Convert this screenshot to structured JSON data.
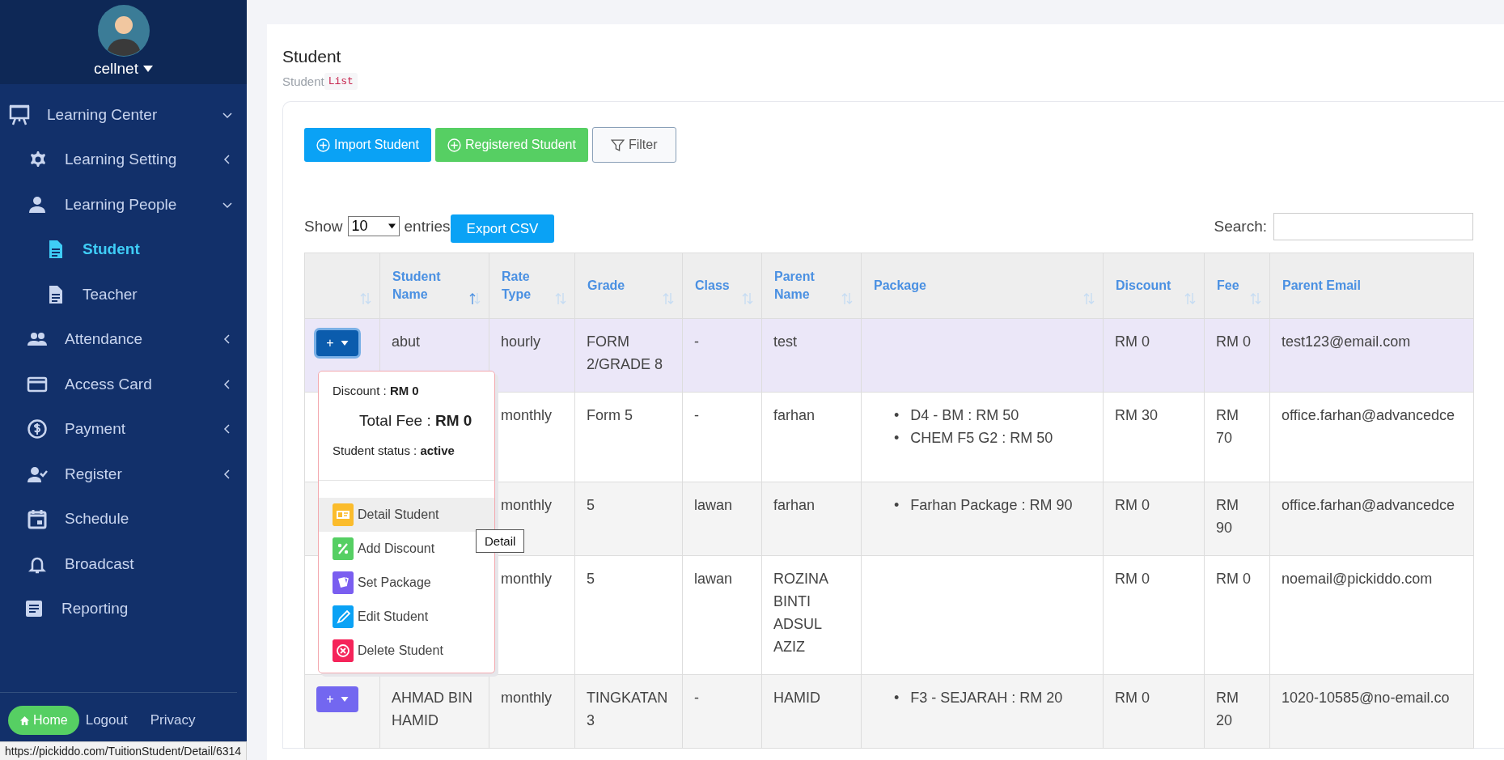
{
  "sidebar": {
    "user": {
      "name": "cellnet"
    },
    "items": [
      {
        "label": "Learning Center",
        "selected": false,
        "expanded": true,
        "children": [
          {
            "label": "Learning Setting",
            "selected": false,
            "expanded": false
          },
          {
            "label": "Learning People",
            "selected": false,
            "expanded": true,
            "children": [
              {
                "label": "Student",
                "selected": true
              },
              {
                "label": "Teacher",
                "selected": false
              }
            ]
          },
          {
            "label": "Attendance",
            "selected": false,
            "expanded": false
          },
          {
            "label": "Access Card",
            "selected": false,
            "expanded": false
          },
          {
            "label": "Payment",
            "selected": false,
            "expanded": false
          },
          {
            "label": "Register",
            "selected": false,
            "expanded": false
          },
          {
            "label": "Schedule",
            "selected": false
          },
          {
            "label": "Broadcast",
            "selected": false
          },
          {
            "label": "Reporting",
            "selected": false
          }
        ]
      }
    ],
    "footer": [
      {
        "label": "Home",
        "kind": "button"
      },
      {
        "label": "Logout",
        "kind": "link"
      },
      {
        "label": "Privacy",
        "kind": "link"
      }
    ]
  },
  "page": {
    "title": "Student",
    "breadcrumb": [
      "Student",
      "List"
    ]
  },
  "toolbar": {
    "buttons": [
      {
        "label": "Import Student",
        "kind": "primary"
      },
      {
        "label": "Registered Student",
        "kind": "success"
      },
      {
        "label": "Filter",
        "kind": "outline"
      }
    ]
  },
  "table_controls": {
    "show_label": "Show",
    "page_size": "10",
    "entries_label": "entries",
    "export_button": "Export CSV",
    "search_label": "Search:"
  },
  "table": {
    "columns": [
      {
        "sortable": true,
        "sorted": false
      },
      {
        "label": "Student Name",
        "sortable": true,
        "sorted": true
      },
      {
        "label": "Rate Type",
        "sortable": true,
        "sorted": false
      },
      {
        "label": "Grade",
        "sortable": true,
        "sorted": false
      },
      {
        "label": "Class",
        "sortable": true,
        "sorted": false
      },
      {
        "label": "Parent Name",
        "sortable": true,
        "sorted": false
      },
      {
        "label": "Package",
        "sortable": true,
        "sorted": false
      },
      {
        "label": "Discount",
        "sortable": true,
        "sorted": false
      },
      {
        "label": "Fee",
        "sortable": true,
        "sorted": false
      },
      {
        "label": "Parent Email",
        "sortable": false
      }
    ],
    "rows": [
      {
        "selected": true,
        "action": {
          "label": "+",
          "color": "#0b5cad",
          "open": true
        },
        "student_name": "abut",
        "rate_type": "hourly",
        "grade": "FORM 2/GRADE 8",
        "class": "-",
        "parent_name": "test",
        "discount": "RM 0",
        "fee": "RM 0",
        "parent_email": "test123@email.com"
      },
      {
        "selected": false,
        "rate_type": "monthly",
        "grade": "Form 5",
        "class": "-",
        "parent_name": "farhan",
        "package": [
          {
            "bullet": "•",
            "text": "D4 - BM : RM 50"
          },
          {
            "bullet": "•",
            "text": "CHEM F5 G2 : RM 50"
          }
        ],
        "discount": "RM 30",
        "fee": "RM 70",
        "parent_email": "office.farhan@advancedce"
      },
      {
        "selected": false,
        "rate_type": "monthly",
        "grade": "5",
        "class": "lawan",
        "parent_name": "farhan",
        "package": [
          {
            "bullet": "•",
            "text": "Farhan Package : RM 90"
          }
        ],
        "discount": "RM 0",
        "fee": "RM 90",
        "parent_email": "office.farhan@advancedce"
      },
      {
        "selected": false,
        "rate_type": "monthly",
        "grade": "5",
        "class": "lawan",
        "parent_name": "ROZINA BINTI ADSUL AZIZ",
        "discount": "RM 0",
        "fee": "RM 0",
        "parent_email": "noemail@pickiddo.com"
      },
      {
        "selected": false,
        "action": {
          "label": "+",
          "color": "#7367f0",
          "open": false
        },
        "student_name": "AHMAD BIN HAMID",
        "rate_type": "monthly",
        "grade": "TINGKATAN 3",
        "class": "-",
        "parent_name": "HAMID",
        "package": [
          {
            "bullet": "•",
            "text": "F3 - SEJARAH : RM 20"
          }
        ],
        "discount": "RM 0",
        "fee": "RM 20",
        "parent_email": "1020-10585@no-email.co"
      }
    ]
  },
  "action_menu": {
    "info": [
      {
        "text": "Discount : **RM 0**",
        "kind": "small"
      },
      {
        "text": "Total Fee : **RM 0**",
        "kind": "large"
      },
      {
        "text": "Student status : **active**",
        "kind": "small"
      }
    ],
    "items": [
      {
        "label": "Detail Student",
        "color": "#fbbc2c",
        "selected": true
      },
      {
        "label": "Add Discount",
        "color": "#55cf63",
        "selected": false
      },
      {
        "label": "Set Package",
        "color": "#7a5ef0",
        "selected": false
      },
      {
        "label": "Edit Student",
        "color": "#0aa2f5",
        "selected": false
      },
      {
        "label": "Delete Student",
        "color": "#f5245a",
        "selected": false
      }
    ]
  },
  "tooltip": {
    "text": "Detail"
  },
  "status_bar": {
    "url": "https://pickiddo.com/TuitionStudent/Detail/6314"
  }
}
